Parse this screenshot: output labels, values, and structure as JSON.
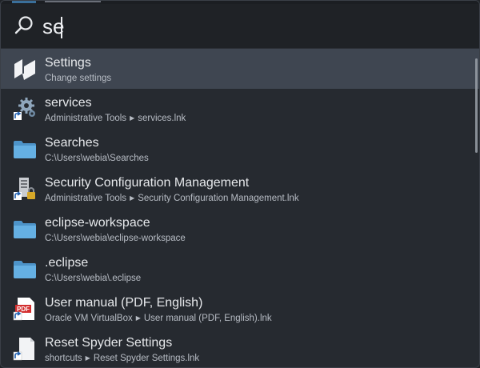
{
  "search": {
    "value": "se"
  },
  "results": [
    {
      "title": "Settings",
      "path": [
        "Change settings"
      ],
      "icon": "settings-app-icon",
      "selected": true
    },
    {
      "title": "services",
      "path": [
        "Administrative Tools",
        "services.lnk"
      ],
      "icon": "gears-shortcut-icon"
    },
    {
      "title": "Searches",
      "path": [
        "C:\\Users\\webia\\Searches"
      ],
      "icon": "folder-icon"
    },
    {
      "title": "Security Configuration Management",
      "path": [
        "Administrative Tools",
        "Security Configuration Management.lnk"
      ],
      "icon": "security-config-shortcut-icon"
    },
    {
      "title": "eclipse-workspace",
      "path": [
        "C:\\Users\\webia\\eclipse-workspace"
      ],
      "icon": "folder-icon"
    },
    {
      "title": ".eclipse",
      "path": [
        "C:\\Users\\webia\\.eclipse"
      ],
      "icon": "folder-icon"
    },
    {
      "title": "User manual (PDF, English)",
      "path": [
        "Oracle VM VirtualBox",
        "User manual (PDF, English).lnk"
      ],
      "icon": "pdf-shortcut-icon"
    },
    {
      "title": "Reset Spyder Settings",
      "path": [
        "shortcuts",
        "Reset Spyder Settings.lnk"
      ],
      "icon": "file-shortcut-icon"
    }
  ],
  "colors": {
    "background": "#262a30",
    "selected_row": "#3f4651",
    "folder": "#5aa3d6",
    "text": "#e6e8eb",
    "subtext": "#b7bcc4"
  }
}
